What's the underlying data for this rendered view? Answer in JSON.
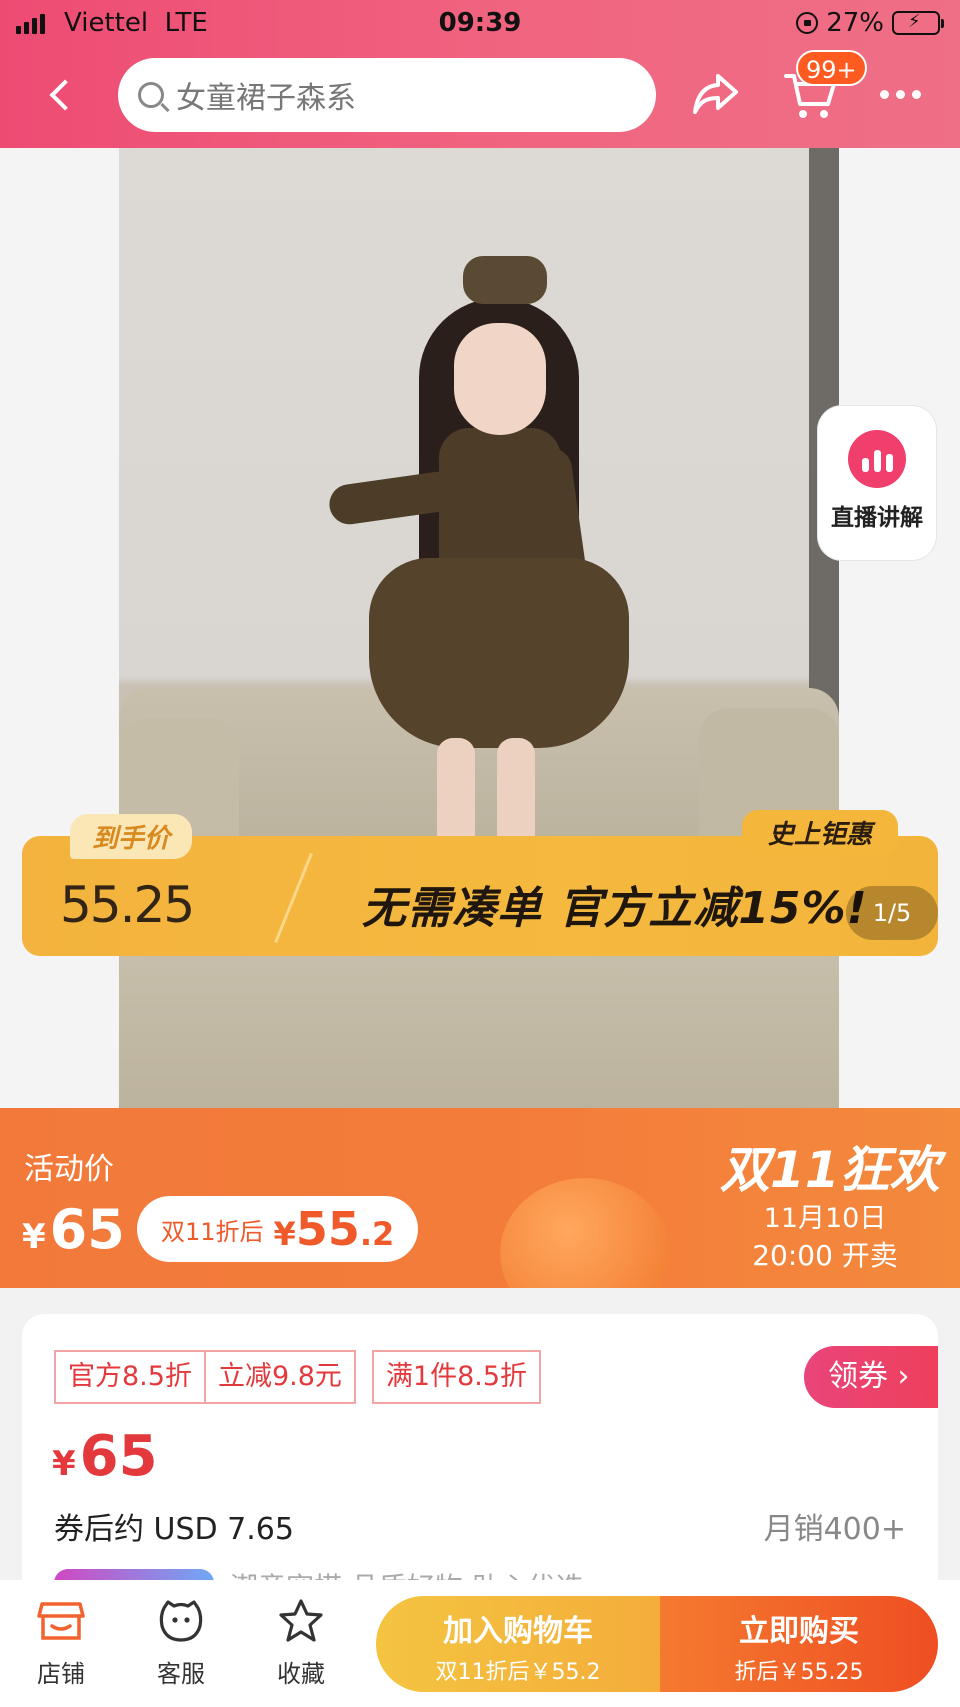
{
  "status_bar": {
    "carrier": "Viettel",
    "network": "LTE",
    "time": "09:39",
    "battery": "27%",
    "battery_level": 0.27
  },
  "nav": {
    "search_placeholder": "女童裙子森系",
    "cart_badge": "99+",
    "icons": [
      "back-icon",
      "search-icon",
      "share-icon",
      "cart-icon",
      "more-icon"
    ]
  },
  "hero": {
    "live_label": "直播讲解",
    "pager": "1/5",
    "promo": {
      "tag": "到手价",
      "price": "55.25",
      "slogan": "无需凑单  官方立减15%!",
      "best_badge": "史上钜惠"
    }
  },
  "activity": {
    "label": "活动价",
    "currency": "¥",
    "price": "65",
    "pill_text": "双11折后",
    "pill_currency": "¥",
    "pill_price": "55",
    "pill_price_decimal": ".2",
    "event_title": "双11狂欢",
    "date": "11月10日",
    "open_time": "20:00 开卖"
  },
  "info": {
    "chips": [
      "官方8.5折",
      "立减9.8元",
      "满1件8.5折"
    ],
    "coupon_button": "领券",
    "currency": "¥",
    "price": "65",
    "usd_price": "券后约 USD 7.65",
    "monthly_sales": "月销400+",
    "next_line": "潮童穿搭 品质好物 助心优选"
  },
  "bottom_bar": {
    "shop": "店铺",
    "service": "客服",
    "favorite": "收藏",
    "add_to_cart": "加入购物车",
    "add_to_cart_sub": "双11折后￥55.2",
    "buy_now": "立即购买",
    "buy_now_sub": "折后￥55.25"
  },
  "colors": {
    "header": "#ee4b73",
    "activity": "#f47d3b",
    "price_red": "#e4393c",
    "cart_button": "#f4c440",
    "buy_button": "#ef4e22"
  }
}
